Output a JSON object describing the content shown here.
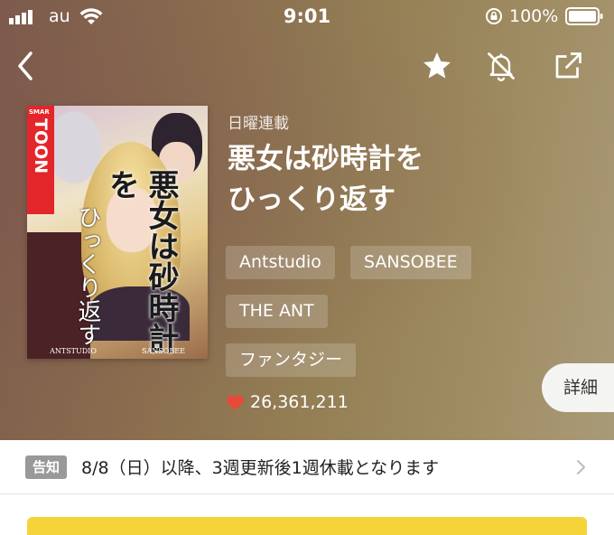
{
  "status_bar": {
    "carrier": "au",
    "time": "9:01",
    "battery_percent": "100%"
  },
  "nav": {
    "back_icon": "chevron-left-icon",
    "favorite_icon": "star-icon",
    "notification_icon": "bell-off-icon",
    "share_icon": "share-icon"
  },
  "cover": {
    "badge_top": "SMAR",
    "badge_main": "TOON",
    "title_main": "悪女は砂時計を",
    "title_sub": "ひっくり返す",
    "credit_left": "ANTSTUDIO",
    "credit_right": "SANSOBEE"
  },
  "comic": {
    "schedule": "日曜連載",
    "title_line1": "悪女は砂時計を",
    "title_line2": "ひっくり返す",
    "tags": [
      "Antstudio",
      "SANSOBEE",
      "THE ANT",
      "ファンタジー"
    ],
    "likes": "26,361,211"
  },
  "detail_button": "詳細",
  "notice": {
    "badge": "告知",
    "text": "8/8（日）以降、3週更新後1週休載となります"
  },
  "colors": {
    "heart": "#e84a3a",
    "bottom_bar": "#f5d43a",
    "notice_badge": "#999999"
  }
}
